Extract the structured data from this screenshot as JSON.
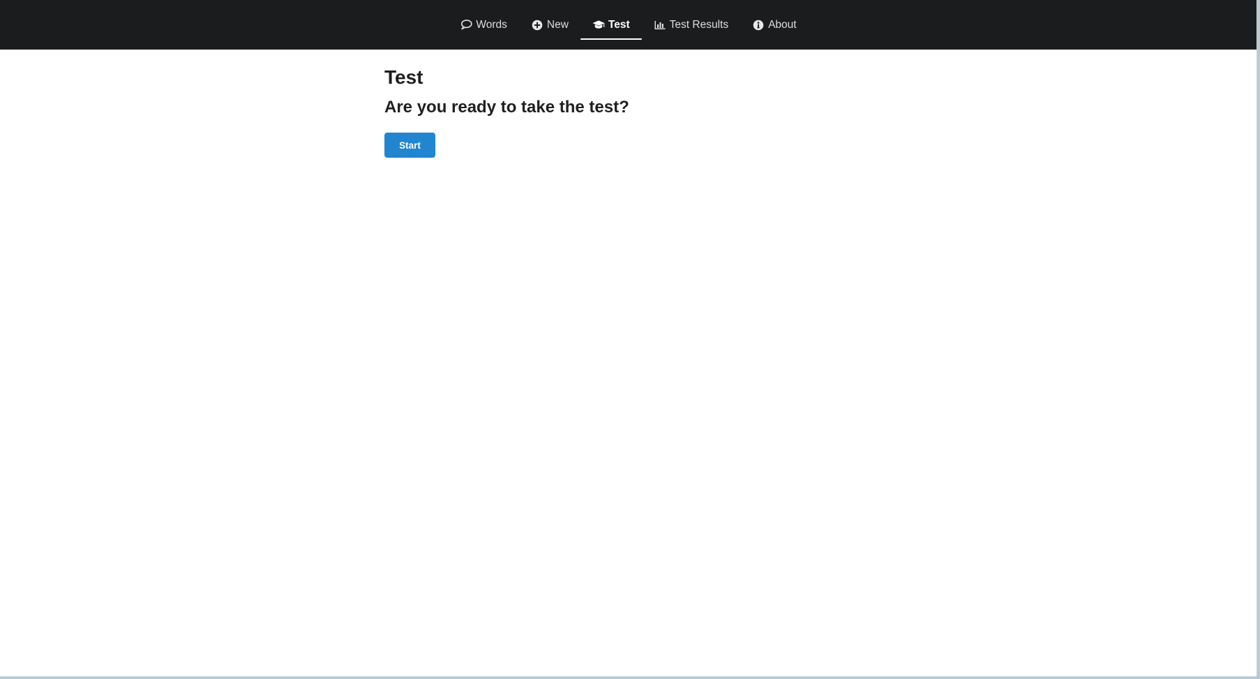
{
  "nav": {
    "items": [
      {
        "label": "Words",
        "icon": "comment-outline-icon"
      },
      {
        "label": "New",
        "icon": "plus-circle-icon"
      },
      {
        "label": "Test",
        "icon": "graduation-cap-icon",
        "active": true
      },
      {
        "label": "Test Results",
        "icon": "bar-chart-icon"
      },
      {
        "label": "About",
        "icon": "info-circle-icon"
      }
    ]
  },
  "main": {
    "title": "Test",
    "question": "Are you ready to take the test?",
    "start_label": "Start"
  },
  "colors": {
    "navbar_bg": "#1b1c1d",
    "primary": "#2185d0",
    "page_bg": "#ffffff"
  }
}
